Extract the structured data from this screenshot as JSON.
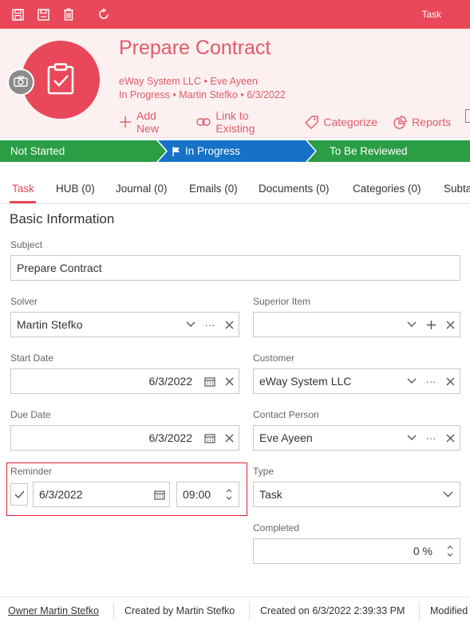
{
  "window": {
    "title": "Task"
  },
  "toolbar": {
    "save_icon": "save-close-icon",
    "save2_icon": "save-icon",
    "delete_icon": "trash-icon",
    "refresh_icon": "refresh-icon"
  },
  "header": {
    "title": "Prepare Contract",
    "line1": "eWay System LLC • Eve Ayeen",
    "line2": "In Progress • Martin Stefko • 6/3/2022",
    "actions": [
      {
        "label": "Add New",
        "icon": "plus-icon"
      },
      {
        "label": "Link to Existing",
        "icon": "link-icon"
      },
      {
        "label": "Categorize",
        "icon": "tag-icon"
      },
      {
        "label": "Reports",
        "icon": "pie-chart-icon"
      }
    ]
  },
  "process": {
    "stages": [
      {
        "label": "Not Started",
        "color": "#2a9d45"
      },
      {
        "label": "In Progress",
        "color": "#1672c7"
      },
      {
        "label": "To Be Reviewed",
        "color": "#2a9d45"
      }
    ]
  },
  "tabs": [
    {
      "label": "Task"
    },
    {
      "label": "HUB (0)"
    },
    {
      "label": "Journal (0)"
    },
    {
      "label": "Emails (0)"
    },
    {
      "label": "Documents (0)"
    },
    {
      "label": "Categories (0)"
    },
    {
      "label": "Subta"
    }
  ],
  "form": {
    "section_title": "Basic Information",
    "subject": {
      "label": "Subject",
      "value": "Prepare Contract"
    },
    "solver": {
      "label": "Solver",
      "value": "Martin Stefko"
    },
    "superior_item": {
      "label": "Superior Item",
      "value": ""
    },
    "start_date": {
      "label": "Start Date",
      "value": "6/3/2022"
    },
    "customer": {
      "label": "Customer",
      "value": "eWay System LLC"
    },
    "due_date": {
      "label": "Due Date",
      "value": "6/3/2022"
    },
    "contact_person": {
      "label": "Contact Person",
      "value": "Eve Ayeen"
    },
    "reminder": {
      "label": "Reminder",
      "date": "6/3/2022",
      "time": "09:00",
      "checked": true
    },
    "type": {
      "label": "Type",
      "value": "Task"
    },
    "completed": {
      "label": "Completed",
      "value": "0 %"
    }
  },
  "footer": {
    "owner": "Owner Martin Stefko",
    "created_by": "Created by Martin Stefko",
    "created_on": "Created on 6/3/2022 2:39:33 PM",
    "modified": "Modified"
  },
  "colors": {
    "accent": "#e9485a",
    "green": "#2a9d45",
    "blue": "#1672c7",
    "reminder_border": "#d9232e"
  }
}
